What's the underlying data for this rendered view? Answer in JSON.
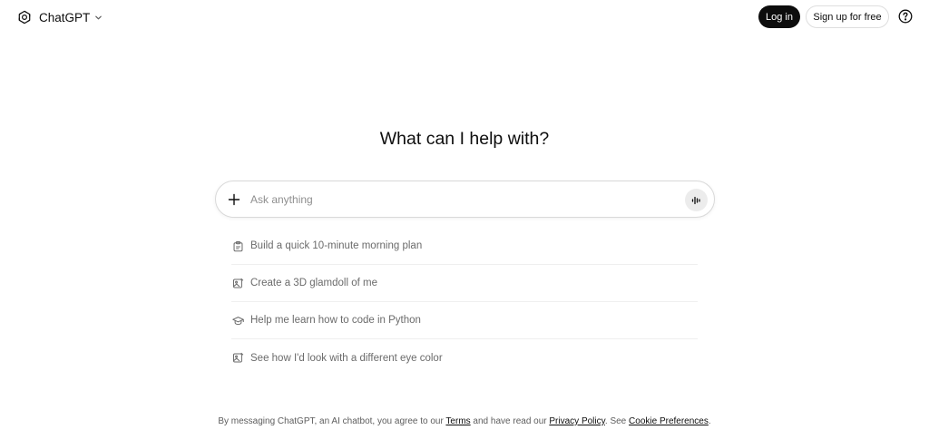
{
  "header": {
    "app_name": "ChatGPT",
    "login_label": "Log in",
    "signup_label": "Sign up for free",
    "icons": [
      "openai-logo-icon",
      "chevron-down-icon",
      "help-icon"
    ]
  },
  "main": {
    "headline": "What can I help with?",
    "composer": {
      "placeholder": "Ask anything",
      "value": "",
      "icons": [
        "plus-icon",
        "voice-mode-icon"
      ]
    },
    "suggestions": [
      {
        "label": "Build a quick 10-minute morning plan",
        "icon": "clipboard-icon"
      },
      {
        "label": "Create a 3D glamdoll of me",
        "icon": "image-edit-icon"
      },
      {
        "label": "Help me learn how to code in Python",
        "icon": "graduation-cap-icon"
      },
      {
        "label": "See how I'd look with a different eye color",
        "icon": "image-edit-icon"
      }
    ]
  },
  "footer": {
    "text_1": "By messaging ChatGPT, an AI chatbot, you agree to our ",
    "terms_link": "Terms",
    "text_2": " and have read our ",
    "privacy_link": "Privacy Policy",
    "text_3": ". See ",
    "cookie_link": "Cookie Preferences",
    "text_4": "."
  },
  "colors": {
    "text_primary": "#0d0d0d",
    "text_secondary": "#6b6b6b",
    "button_dark": "#0d0d0d",
    "border": "#d9d9d9",
    "background": "#ffffff"
  }
}
